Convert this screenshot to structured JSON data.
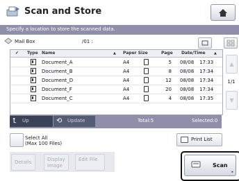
{
  "header": {
    "title": "Scan and Store"
  },
  "info": {
    "message": "Specify a location to store the scanned data."
  },
  "location": {
    "name": "Mail Box",
    "path": "/01 :"
  },
  "table": {
    "columns": {
      "check": "✔",
      "type": "Type",
      "name": "Name",
      "paper_size": "Paper Size",
      "page": "Page",
      "datetime": "Date/Time"
    },
    "rows": [
      {
        "name": "Document_A",
        "size": "A4",
        "pages": "5",
        "date": "08/08",
        "time": "17:33"
      },
      {
        "name": "Document_B",
        "size": "A4",
        "pages": "8",
        "date": "08/08",
        "time": "17:34"
      },
      {
        "name": "Document_D",
        "size": "A4",
        "pages": "12",
        "date": "08/08",
        "time": "17:34"
      },
      {
        "name": "Document_F",
        "size": "A4",
        "pages": "20",
        "date": "08/08",
        "time": "17:34"
      },
      {
        "name": "Document_C",
        "size": "A4",
        "pages": "4",
        "date": "08/08",
        "time": "17:35"
      }
    ]
  },
  "pager": {
    "page_text": "1/1",
    "up_arrow": "▲",
    "down_arrow": "▼"
  },
  "nav": {
    "up_label": "Up",
    "update_label": "Update",
    "total": "Total:5",
    "selected": "Selected:0"
  },
  "select_all": {
    "line1": "Select All",
    "line2": "(Max 100 Files)"
  },
  "print_list": {
    "label": "Print List"
  },
  "actions": {
    "details": "Details",
    "display_image_1": "Display",
    "display_image_2": "Image",
    "edit_file": "Edit File"
  },
  "scan": {
    "label": "Scan"
  },
  "colors": {
    "info_bar": "#8f8fab",
    "nav_bar": "#8f8fab",
    "up_button": "#3a4258"
  }
}
